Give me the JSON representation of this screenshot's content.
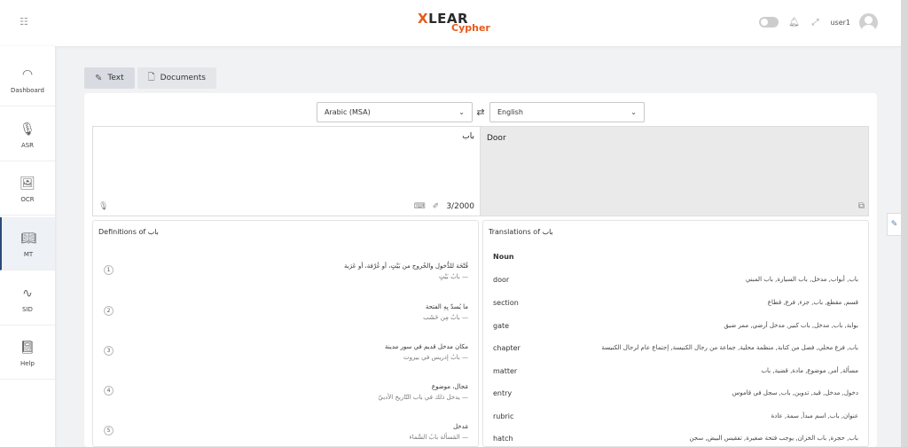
{
  "header": {
    "logo_part1_x": "X",
    "logo_part1_rest": "LEAR",
    "logo_part2": "Cypher",
    "username": "user1"
  },
  "sidebar": {
    "items": [
      {
        "label": "Dashboard",
        "icon": "gauge-icon"
      },
      {
        "label": "ASR",
        "icon": "microphone-icon"
      },
      {
        "label": "OCR",
        "icon": "image-icon"
      },
      {
        "label": "MT",
        "icon": "book-icon",
        "active": true
      },
      {
        "label": "SID",
        "icon": "waveform-icon"
      },
      {
        "label": "Help",
        "icon": "help-book-icon"
      }
    ]
  },
  "tabs": [
    {
      "label": "Text",
      "active": true
    },
    {
      "label": "Documents",
      "active": false
    }
  ],
  "translator": {
    "source_language": "Arabic (MSA)",
    "target_language": "English",
    "source_text": "باب",
    "char_count": "3/2000",
    "target_text": "Door"
  },
  "definitions": {
    "title": "Definitions of باب",
    "items": [
      {
        "num": "1",
        "main": "فُتْحَة للدُّخول والخُروج من بَيْتٍ، أو غُرْفة، أو عَرَبة",
        "example": "— بابُ بَيْتٍ"
      },
      {
        "num": "2",
        "main": "ما يُسدّ بِهِ الفتحة",
        "example": "— بابٌ مِن خَشَب"
      },
      {
        "num": "3",
        "main": "مكان مدخل قديم في سور مدينة",
        "example": "— بابُ إدريس في بيروت"
      },
      {
        "num": "4",
        "main": "مَجال، موضوع",
        "example": "— يدخل ذلك في باب التّاريخ الأدبيّ"
      },
      {
        "num": "5",
        "main": "مَدخل",
        "example": "— المَسألة بابُ السَّماء"
      }
    ]
  },
  "translations": {
    "title": "Translations of باب",
    "pos": "Noun",
    "items": [
      {
        "en": "door",
        "ar": "باب, أبواب, مدخل, باب السيارة, باب المبني"
      },
      {
        "en": "section",
        "ar": "قسم, مقطع, باب, جزء, فرع, قطاع"
      },
      {
        "en": "gate",
        "ar": "بوابة, باب, مدخل, باب كبير, مدخل أرضي, ممر ضيق"
      },
      {
        "en": "chapter",
        "ar": "باب, فرع محلي, فصل من كتابة, منظمة محلية, جماعة من رجال الكنيسة, إجتماع عام لرجال الكنيسة"
      },
      {
        "en": "matter",
        "ar": "مسألة, أمر, موضوع, مادة, قضية, باب"
      },
      {
        "en": "entry",
        "ar": "دخول, مدخل, قيد, تدوين, باب, سجل في قاموس"
      },
      {
        "en": "rubric",
        "ar": "عنوان, باب, اسم مبدأ, سمة, عادة"
      },
      {
        "en": "hatch",
        "ar": "باب, حجرة, باب الخزان, يوجب فتحة صغيرة, تفقيس البيض, سجن"
      }
    ]
  }
}
